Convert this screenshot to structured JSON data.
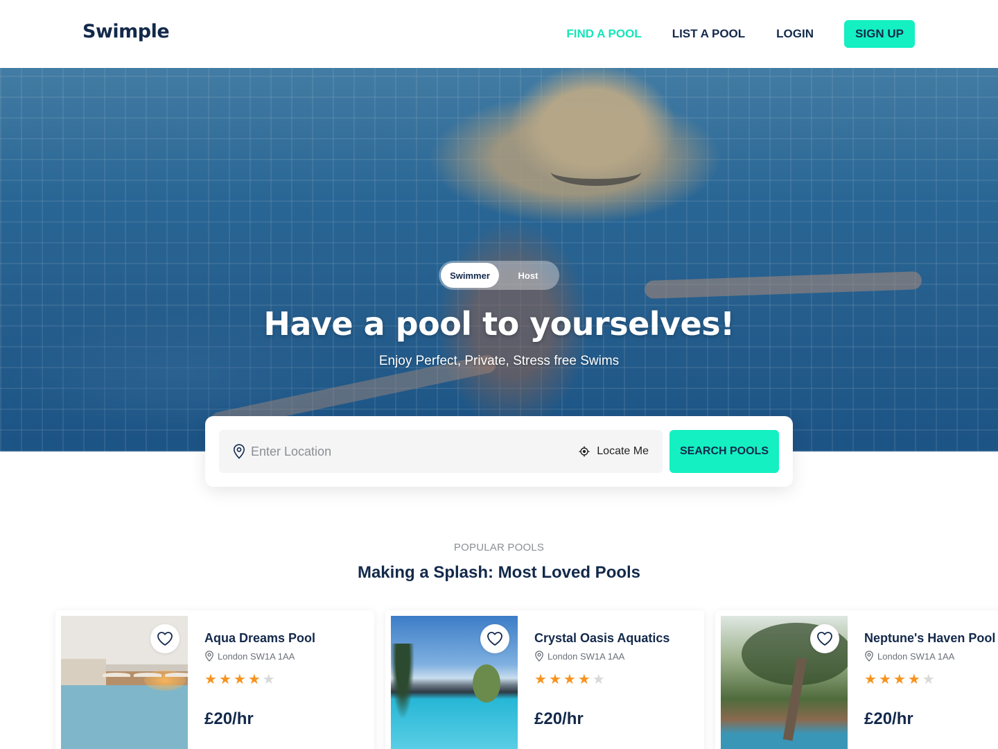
{
  "header": {
    "logo": "Swimple",
    "nav": {
      "find": "FIND A POOL",
      "list": "LIST A POOL",
      "login": "LOGIN",
      "signup": "SIGN UP"
    },
    "active_color": "#14e5b8",
    "brand_color": "#13294b",
    "accent_color": "#14f0c2"
  },
  "hero": {
    "toggle": {
      "swimmer": "Swimmer",
      "host": "Host",
      "selected": "Swimmer"
    },
    "title": "Have a pool to yourselves!",
    "subtitle": "Enjoy Perfect, Private, Stress free Swims"
  },
  "search": {
    "placeholder": "Enter Location",
    "value": "",
    "locate_label": "Locate Me",
    "button": "SEARCH POOLS",
    "pin_icon": "location-pin-icon",
    "locate_icon": "crosshair-icon"
  },
  "popular": {
    "eyebrow": "POPULAR POOLS",
    "title": "Making a Splash: Most Loved Pools",
    "pools": [
      {
        "name": "Aqua Dreams Pool",
        "location": "London SW1A 1AA",
        "rating": 4,
        "max_rating": 5,
        "price": "£20/hr"
      },
      {
        "name": "Crystal Oasis Aquatics",
        "location": "London SW1A 1AA",
        "rating": 4,
        "max_rating": 5,
        "price": "£20/hr"
      },
      {
        "name": "Neptune's Haven Pool",
        "location": "London SW1A 1AA",
        "rating": 4,
        "max_rating": 5,
        "price": "£20/hr"
      }
    ],
    "star_color": "#f7931e",
    "star_empty_color": "#d9d9d9"
  }
}
